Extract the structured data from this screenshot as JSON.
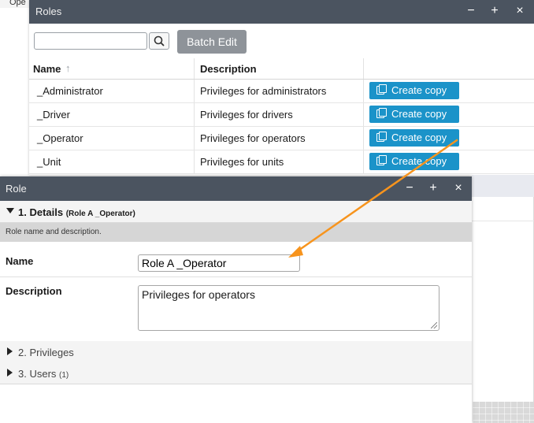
{
  "background": {
    "tab_fragment": "Ope"
  },
  "roles_window": {
    "title": "Roles",
    "controls": {
      "minimize": "−",
      "maximize": "+",
      "close": "×"
    },
    "search": {
      "value": "",
      "placeholder": ""
    },
    "batch_edit_label": "Batch Edit",
    "columns": {
      "name": "Name",
      "description": "Description",
      "sort_icon": "↑"
    },
    "rows": [
      {
        "name": "_Administrator",
        "description": "Privileges for administrators",
        "action": "Create copy"
      },
      {
        "name": "_Driver",
        "description": "Privileges for drivers",
        "action": "Create copy"
      },
      {
        "name": "_Operator",
        "description": "Privileges for operators",
        "action": "Create copy"
      },
      {
        "name": "_Unit",
        "description": "Privileges for units",
        "action": "Create copy"
      }
    ]
  },
  "role_dialog": {
    "title": "Role",
    "controls": {
      "minimize": "−",
      "maximize": "+",
      "close": "×"
    },
    "sections": {
      "details": {
        "label": "1. Details",
        "sub": "(Role A _Operator)",
        "hint": "Role name and description."
      },
      "privileges": {
        "label": "2. Privileges"
      },
      "users": {
        "label": "3. Users",
        "count": "(1)"
      }
    },
    "fields": {
      "name_label": "Name",
      "name_value": "Role A _Operator",
      "description_label": "Description",
      "description_value": "Privileges for operators"
    }
  },
  "colors": {
    "titlebar": "#4b5460",
    "copy_button": "#1b93c9",
    "batch_button": "#8e9399",
    "annotation_arrow": "#f7941d"
  }
}
